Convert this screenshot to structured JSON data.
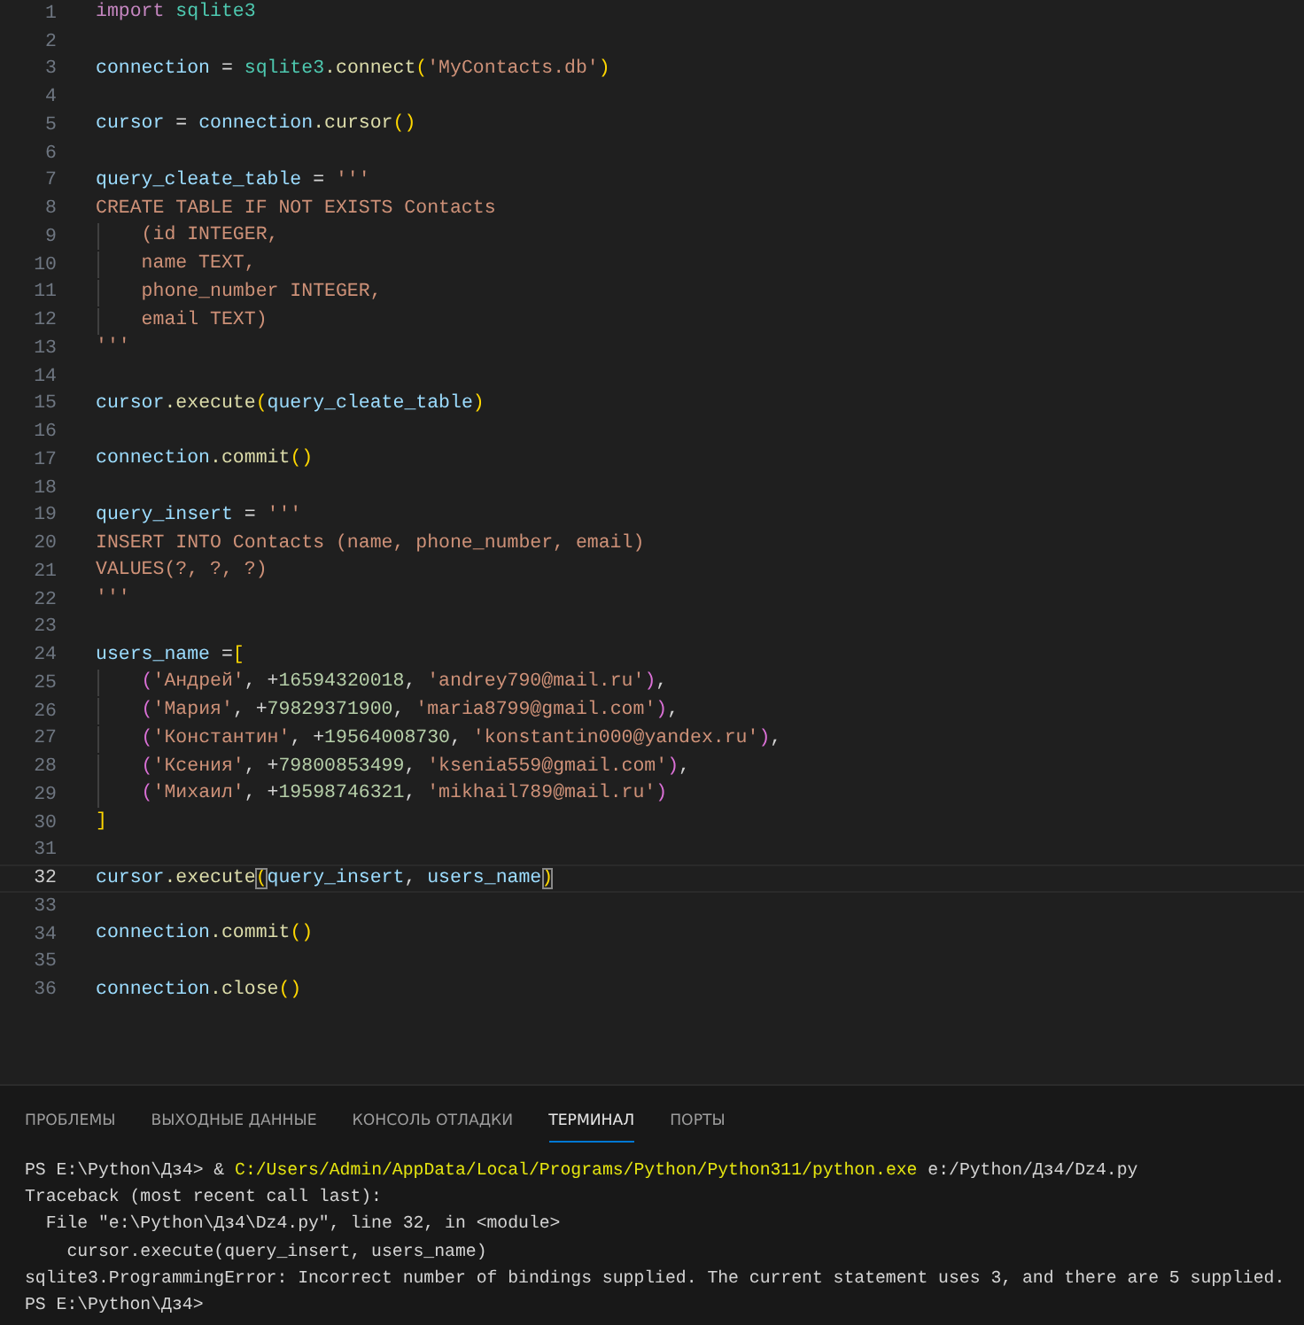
{
  "editor": {
    "lines": [
      {
        "number": "1",
        "current": false,
        "guide": false,
        "tokens": [
          {
            "text": "import ",
            "kind": "keyword"
          },
          {
            "text": "sqlite3",
            "kind": "module"
          }
        ]
      },
      {
        "number": "2",
        "current": false
      },
      {
        "number": "3",
        "current": false,
        "guide": false,
        "tokens": [
          {
            "text": "connection",
            "kind": "variable"
          },
          {
            "text": " = ",
            "kind": "plain"
          },
          {
            "text": "sqlite3",
            "kind": "module"
          },
          {
            "text": ".connect",
            "kind": "function"
          },
          {
            "text": "(",
            "kind": "bracket1"
          },
          {
            "text": "'MyContacts.db'",
            "kind": "string"
          },
          {
            "text": ")",
            "kind": "bracket1"
          }
        ]
      },
      {
        "number": "4",
        "current": false
      },
      {
        "number": "5",
        "current": false,
        "guide": false,
        "tokens": [
          {
            "text": "cursor",
            "kind": "variable"
          },
          {
            "text": " = ",
            "kind": "plain"
          },
          {
            "text": "connection",
            "kind": "variable"
          },
          {
            "text": ".cursor",
            "kind": "function"
          },
          {
            "text": "()",
            "kind": "bracket1"
          }
        ]
      },
      {
        "number": "6",
        "current": false
      },
      {
        "number": "7",
        "current": false,
        "guide": false,
        "tokens": [
          {
            "text": "query_cleate_table",
            "kind": "variable"
          },
          {
            "text": " = ",
            "kind": "plain"
          },
          {
            "text": "'''",
            "kind": "string"
          }
        ]
      },
      {
        "number": "8",
        "current": false,
        "guide": false,
        "tokens": [
          {
            "text": "CREATE TABLE IF NOT EXISTS Contacts",
            "kind": "string"
          }
        ]
      },
      {
        "number": "9",
        "current": false,
        "guide": true,
        "tokens": [
          {
            "text": "    (id INTEGER,",
            "kind": "string"
          }
        ]
      },
      {
        "number": "10",
        "current": false,
        "guide": true,
        "tokens": [
          {
            "text": "    name TEXT,",
            "kind": "string"
          }
        ]
      },
      {
        "number": "11",
        "current": false,
        "guide": true,
        "tokens": [
          {
            "text": "    phone_number INTEGER,",
            "kind": "string"
          }
        ]
      },
      {
        "number": "12",
        "current": false,
        "guide": true,
        "tokens": [
          {
            "text": "    email TEXT)",
            "kind": "string"
          }
        ]
      },
      {
        "number": "13",
        "current": false,
        "guide": false,
        "tokens": [
          {
            "text": "'''",
            "kind": "string"
          }
        ]
      },
      {
        "number": "14",
        "current": false
      },
      {
        "number": "15",
        "current": false,
        "guide": false,
        "tokens": [
          {
            "text": "cursor",
            "kind": "variable"
          },
          {
            "text": ".execute",
            "kind": "function"
          },
          {
            "text": "(",
            "kind": "bracket1"
          },
          {
            "text": "query_cleate_table",
            "kind": "variable"
          },
          {
            "text": ")",
            "kind": "bracket1"
          }
        ]
      },
      {
        "number": "16",
        "current": false
      },
      {
        "number": "17",
        "current": false,
        "guide": false,
        "tokens": [
          {
            "text": "connection",
            "kind": "variable"
          },
          {
            "text": ".commit",
            "kind": "function"
          },
          {
            "text": "()",
            "kind": "bracket1"
          }
        ]
      },
      {
        "number": "18",
        "current": false
      },
      {
        "number": "19",
        "current": false,
        "guide": false,
        "tokens": [
          {
            "text": "query_insert",
            "kind": "variable"
          },
          {
            "text": " = ",
            "kind": "plain"
          },
          {
            "text": "'''",
            "kind": "string"
          }
        ]
      },
      {
        "number": "20",
        "current": false,
        "guide": false,
        "tokens": [
          {
            "text": "INSERT INTO Contacts (name, phone_number, email)",
            "kind": "string"
          }
        ]
      },
      {
        "number": "21",
        "current": false,
        "guide": false,
        "tokens": [
          {
            "text": "VALUES(?, ?, ?)",
            "kind": "string"
          }
        ]
      },
      {
        "number": "22",
        "current": false,
        "guide": false,
        "tokens": [
          {
            "text": "'''",
            "kind": "string"
          }
        ]
      },
      {
        "number": "23",
        "current": false
      },
      {
        "number": "24",
        "current": false,
        "guide": false,
        "tokens": [
          {
            "text": "users_name",
            "kind": "variable"
          },
          {
            "text": " =",
            "kind": "plain"
          },
          {
            "text": "[",
            "kind": "bracket1"
          }
        ]
      },
      {
        "number": "25",
        "current": false,
        "guide": true,
        "tokens": [
          {
            "text": "    (",
            "kind": "bracket2"
          },
          {
            "text": "'Андрей'",
            "kind": "string"
          },
          {
            "text": ", +",
            "kind": "plain"
          },
          {
            "text": "16594320018",
            "kind": "number"
          },
          {
            "text": ", ",
            "kind": "plain"
          },
          {
            "text": "'andrey790@mail.ru'",
            "kind": "string"
          },
          {
            "text": ")",
            "kind": "bracket2"
          },
          {
            "text": ",",
            "kind": "plain"
          }
        ]
      },
      {
        "number": "26",
        "current": false,
        "guide": true,
        "tokens": [
          {
            "text": "    (",
            "kind": "bracket2"
          },
          {
            "text": "'Мария'",
            "kind": "string"
          },
          {
            "text": ", +",
            "kind": "plain"
          },
          {
            "text": "79829371900",
            "kind": "number"
          },
          {
            "text": ", ",
            "kind": "plain"
          },
          {
            "text": "'maria8799@gmail.com'",
            "kind": "string"
          },
          {
            "text": ")",
            "kind": "bracket2"
          },
          {
            "text": ",",
            "kind": "plain"
          }
        ]
      },
      {
        "number": "27",
        "current": false,
        "guide": true,
        "tokens": [
          {
            "text": "    (",
            "kind": "bracket2"
          },
          {
            "text": "'Константин'",
            "kind": "string"
          },
          {
            "text": ", +",
            "kind": "plain"
          },
          {
            "text": "19564008730",
            "kind": "number"
          },
          {
            "text": ", ",
            "kind": "plain"
          },
          {
            "text": "'konstantin000@yandex.ru'",
            "kind": "string"
          },
          {
            "text": ")",
            "kind": "bracket2"
          },
          {
            "text": ",",
            "kind": "plain"
          }
        ]
      },
      {
        "number": "28",
        "current": false,
        "guide": true,
        "tokens": [
          {
            "text": "    (",
            "kind": "bracket2"
          },
          {
            "text": "'Ксения'",
            "kind": "string"
          },
          {
            "text": ", +",
            "kind": "plain"
          },
          {
            "text": "79800853499",
            "kind": "number"
          },
          {
            "text": ", ",
            "kind": "plain"
          },
          {
            "text": "'ksenia559@gmail.com'",
            "kind": "string"
          },
          {
            "text": ")",
            "kind": "bracket2"
          },
          {
            "text": ",",
            "kind": "plain"
          }
        ]
      },
      {
        "number": "29",
        "current": false,
        "guide": true,
        "tokens": [
          {
            "text": "    (",
            "kind": "bracket2"
          },
          {
            "text": "'Михаил'",
            "kind": "string"
          },
          {
            "text": ", +",
            "kind": "plain"
          },
          {
            "text": "19598746321",
            "kind": "number"
          },
          {
            "text": ", ",
            "kind": "plain"
          },
          {
            "text": "'mikhail789@mail.ru'",
            "kind": "string"
          },
          {
            "text": ")",
            "kind": "bracket2"
          }
        ]
      },
      {
        "number": "30",
        "current": false,
        "guide": false,
        "tokens": [
          {
            "text": "]",
            "kind": "bracket1"
          }
        ]
      },
      {
        "number": "31",
        "current": false
      },
      {
        "number": "32",
        "current": true,
        "guide": false,
        "tokens": [
          {
            "text": "cursor",
            "kind": "variable"
          },
          {
            "text": ".execute",
            "kind": "function"
          },
          {
            "text": "(",
            "kind": "bracket_match"
          },
          {
            "text": "query_insert",
            "kind": "variable"
          },
          {
            "text": ", ",
            "kind": "plain"
          },
          {
            "text": "users_name",
            "kind": "variable"
          },
          {
            "text": ")",
            "kind": "bracket_match"
          }
        ]
      },
      {
        "number": "33",
        "current": false
      },
      {
        "number": "34",
        "current": false,
        "guide": false,
        "tokens": [
          {
            "text": "connection",
            "kind": "variable"
          },
          {
            "text": ".commit",
            "kind": "function"
          },
          {
            "text": "()",
            "kind": "bracket1"
          }
        ]
      },
      {
        "number": "35",
        "current": false
      },
      {
        "number": "36",
        "current": false,
        "guide": false,
        "tokens": [
          {
            "text": "connection",
            "kind": "variable"
          },
          {
            "text": ".close",
            "kind": "function"
          },
          {
            "text": "()",
            "kind": "bracket1"
          }
        ]
      }
    ]
  },
  "panel": {
    "tabs": [
      {
        "label": "ПРОБЛЕМЫ",
        "selected": false
      },
      {
        "label": "ВЫХОДНЫЕ ДАННЫЕ",
        "selected": false
      },
      {
        "label": "КОНСОЛЬ ОТЛАДКИ",
        "selected": false
      },
      {
        "label": "ТЕРМИНАЛ",
        "selected": true
      },
      {
        "label": "ПОРТЫ",
        "selected": false
      }
    ],
    "terminal": [
      [
        {
          "text": "PS E:\\Python\\Дз4> & ",
          "kind": "plain"
        },
        {
          "text": "C:/Users/Admin/AppData/Local/Programs/Python/Python311/python.exe",
          "kind": "command"
        },
        {
          "text": " e:/Python/Дз4/Dz4.py",
          "kind": "plain"
        }
      ],
      [
        {
          "text": "Traceback (most recent call last):",
          "kind": "plain"
        }
      ],
      [
        {
          "text": "  File \"e:\\Python\\Дз4\\Dz4.py\", line 32, in <module>",
          "kind": "plain"
        }
      ],
      [
        {
          "text": "    cursor.execute(query_insert, users_name)",
          "kind": "plain"
        }
      ],
      [
        {
          "text": "sqlite3.ProgrammingError: Incorrect number of bindings supplied. The current statement uses 3, and there are 5 supplied.",
          "kind": "plain"
        }
      ],
      [
        {
          "text": "PS E:\\Python\\Дз4>",
          "kind": "plain"
        }
      ]
    ]
  }
}
